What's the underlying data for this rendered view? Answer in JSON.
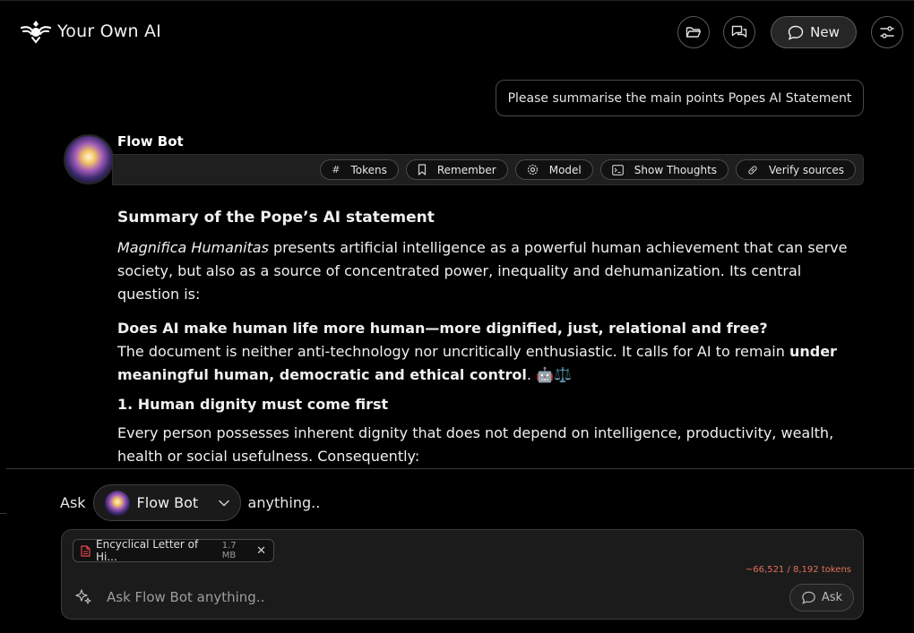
{
  "header": {
    "brand_name": "Your Own AI",
    "new_label": "New"
  },
  "conversation": {
    "user_message": "Please summarise the main points Popes AI Statement",
    "bot_name": "Flow Bot",
    "toolbar": {
      "tokens": "Tokens",
      "remember": "Remember",
      "model": "Model",
      "show_thoughts": "Show Thoughts",
      "verify_sources": "Verify sources"
    },
    "response": {
      "heading": "Summary of the Pope’s AI statement",
      "p1_italic": "Magnifica Humanitas",
      "p1_rest": " presents artificial intelligence as a powerful human achievement that can serve society, but also as a source of concentrated power, inequality and dehumanization. Its central question is:",
      "question": "Does AI make human life more human—more dignified, just, relational and free?",
      "p2_start": "The document is neither anti-technology nor uncritically enthusiastic. It calls for AI to remain ",
      "p2_bold": "under meaningful human, democratic and ethical control",
      "p2_end": ". 🤖⚖️",
      "section1_title": "1. Human dignity must come first",
      "p3": "Every person possesses inherent dignity that does not depend on intelligence, productivity, wealth, health or social usefulness. Consequently:"
    }
  },
  "composer": {
    "ask_prefix": "Ask",
    "selected_model": "Flow Bot",
    "ask_suffix": "anything..",
    "attachment_name": "Encyclical Letter of Hi...",
    "attachment_size": "1.7 MB",
    "token_count": "~66,521 / 8,192 tokens",
    "input_placeholder": "Ask Flow Bot anything..",
    "ask_button": "Ask"
  },
  "colors": {
    "background": "#000000",
    "surface": "#1b1b1b",
    "border": "#4a4a4a",
    "token_warning": "#e0705a",
    "file_icon": "#e5484d"
  },
  "icons": {
    "brand": "spirit-logo-icon",
    "folder": "folder-open-icon",
    "chats": "chat-bubbles-icon",
    "new": "chat-bubble-icon",
    "settings": "sliders-icon",
    "tokens": "hash-icon",
    "remember": "bookmark-icon",
    "model": "gear-icon",
    "thoughts": "terminal-icon",
    "verify": "link-icon",
    "dropdown": "chevron-down-icon",
    "attachment": "pdf-file-icon",
    "remove": "close-icon",
    "magic": "sparkles-icon",
    "ask": "chat-bubble-icon"
  }
}
